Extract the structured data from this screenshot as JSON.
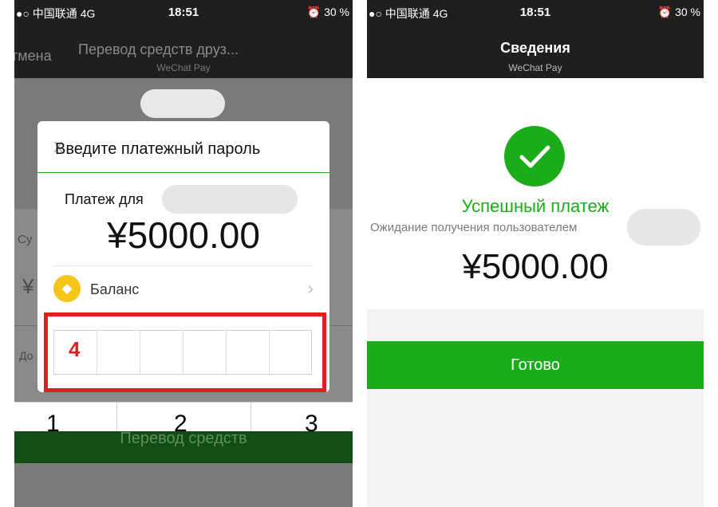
{
  "left": {
    "status": {
      "carrier": "●○ 中国联通  4G",
      "time": "18:51",
      "battery": "⏰ 30 %"
    },
    "nav": {
      "cancel": "тмена",
      "title": "Перевод средств друз...",
      "subtitle": "WeChat Pay"
    },
    "background_fragments": [
      "Су",
      "¥",
      "До"
    ],
    "transfer_button": "Перевод средств",
    "keypad": [
      "1",
      "2",
      "3"
    ],
    "modal": {
      "close": "X",
      "title": "Введите платежный пароль",
      "pay_for": "Платеж для",
      "amount": "¥5000.00",
      "method": "Баланс",
      "password_cells": 6,
      "step_label": "4"
    }
  },
  "right": {
    "status": {
      "carrier": "●○ 中国联通  4G",
      "time": "18:51",
      "battery": "⏰ 30 %"
    },
    "nav": {
      "title": "Сведения",
      "subtitle": "WeChat Pay"
    },
    "success": "Успешный платеж",
    "waiting": "Ожидание получения пользователем",
    "amount": "¥5000.00",
    "done_button": "Готово"
  },
  "colors": {
    "wechat_green": "#1aad19",
    "highlight_red": "#e02020",
    "coin_gold": "#f5c518"
  },
  "icons": {
    "balance": "gem-coin-icon",
    "success": "checkmark-icon",
    "chevron": "chevron-right-icon"
  }
}
